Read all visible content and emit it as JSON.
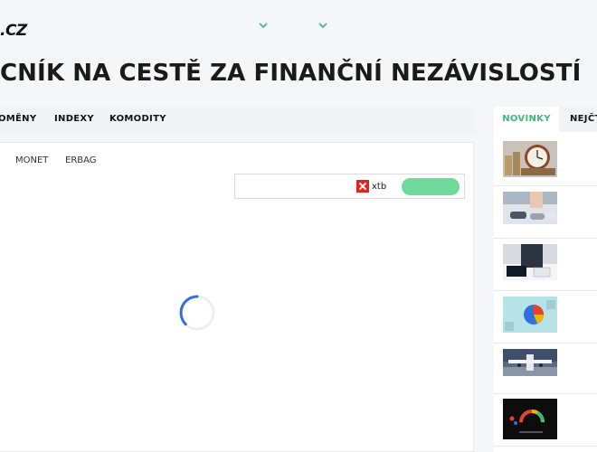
{
  "header": {
    "logo_text": ".CZ",
    "headline": "CNÍK NA CESTĚ ZA FINANČNÍ NEZÁVISLOSTÍ"
  },
  "menu": {
    "items": [
      {
        "label": "OMĚNY"
      },
      {
        "label": "INDEXY"
      },
      {
        "label": "KOMODITY"
      }
    ]
  },
  "sub_tabs": [
    {
      "label": "MONET"
    },
    {
      "label": "ERBAG"
    }
  ],
  "ad": {
    "brand": "xtb",
    "brand_color": "#e5231b",
    "button_color": "#6fd89b"
  },
  "sidebar": {
    "tabs": [
      {
        "label": "NOVINKY",
        "active": true
      },
      {
        "label": "NEJČTĚ"
      }
    ],
    "accent": "#3dbb7a",
    "news": [
      {
        "icon": "clock-coins-thumbnail"
      },
      {
        "icon": "car-keys-thumbnail"
      },
      {
        "icon": "laptop-calculator-thumbnail"
      },
      {
        "icon": "pie-chart-thumbnail"
      },
      {
        "icon": "airplane-thumbnail"
      },
      {
        "icon": "credit-score-gauge-thumbnail"
      }
    ]
  }
}
